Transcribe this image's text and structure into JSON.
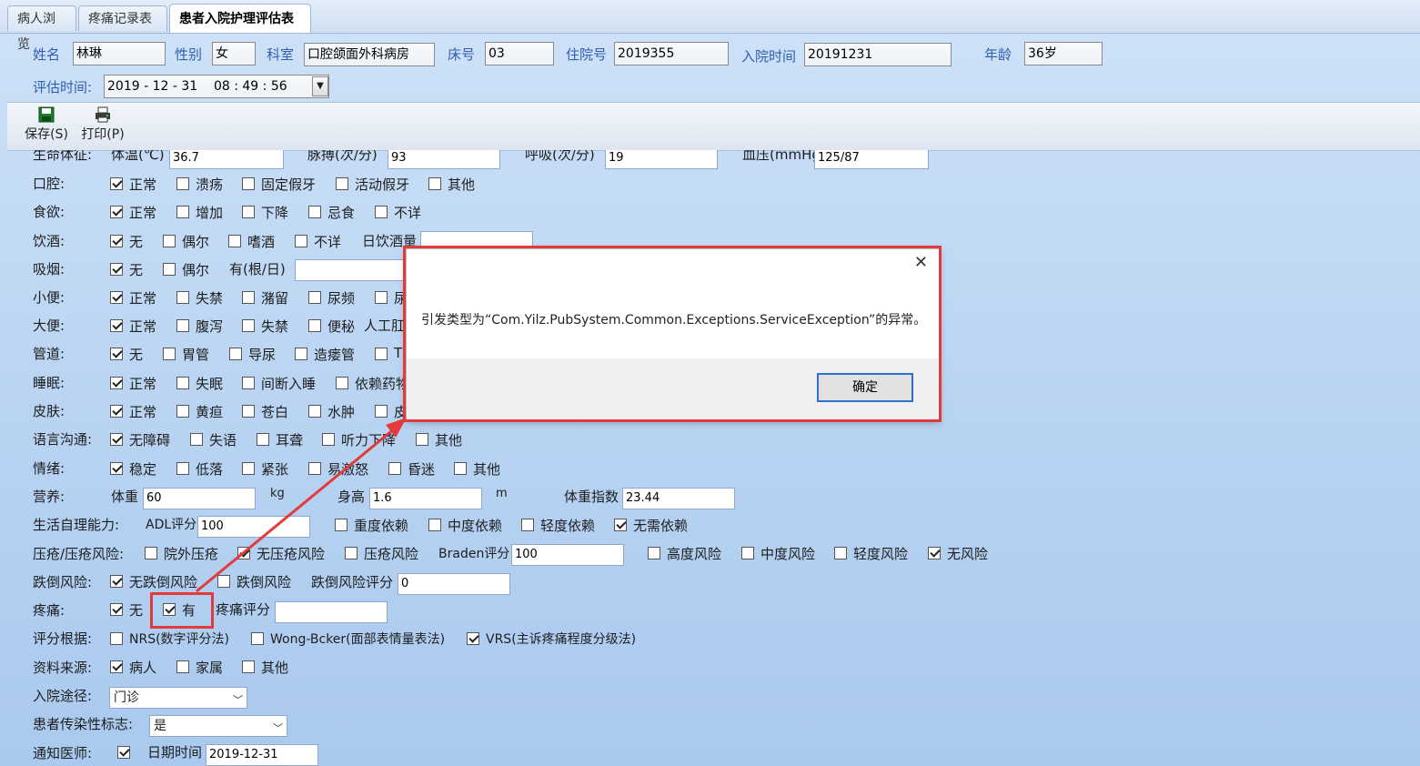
{
  "tabs": [
    "病人浏览",
    "疼痛记录表",
    "患者入院护理评估表"
  ],
  "header": {
    "name_label": "姓名",
    "name_value": "林琳",
    "gender_label": "性别",
    "gender_value": "女",
    "dept_label": "科室",
    "dept_value": "口腔颌面外科病房",
    "bed_label": "床号",
    "bed_value": "03",
    "admission_no_label": "住院号",
    "admission_no_value": "2019355",
    "admit_time_label": "入院时间",
    "admit_time_value": "20191231",
    "age_label": "年龄",
    "age_value": "36岁",
    "assess_time_label": "评估时间:",
    "assess_time_value": "2019 - 12 - 31    08 : 49 : 56"
  },
  "toolbar": {
    "save": "保存(S)",
    "print": "打印(P)"
  },
  "vitals": {
    "label": "生命体征:",
    "temp_label": "体温(℃)",
    "temp_value": "36.7",
    "pulse_label": "脉搏(次/分)",
    "pulse_value": "93",
    "resp_label": "呼吸(次/分)",
    "resp_value": "19",
    "bp_label": "血压(mmHg)",
    "bp_value": "125/87"
  },
  "rows": {
    "oral": {
      "label": "口腔:",
      "opts": [
        "正常",
        "溃疡",
        "固定假牙",
        "活动假牙",
        "其他"
      ]
    },
    "appetite": {
      "label": "食欲:",
      "opts": [
        "正常",
        "增加",
        "下降",
        "忌食",
        "不详"
      ]
    },
    "drink": {
      "label": "饮酒:",
      "opts": [
        "无",
        "偶尔",
        "嗜酒",
        "不详"
      ],
      "daily_label": "日饮酒量"
    },
    "smoke": {
      "label": "吸烟:",
      "opts": [
        "无",
        "偶尔"
      ],
      "per_day_label": "有(根/日)"
    },
    "urine": {
      "label": "小便:",
      "opts": [
        "正常",
        "失禁",
        "潴留",
        "尿频",
        "尿"
      ]
    },
    "stool": {
      "label": "大便:",
      "opts": [
        "正常",
        "腹泻",
        "失禁",
        "便秘"
      ],
      "extra": "人工肛"
    },
    "tube": {
      "label": "管道:",
      "opts": [
        "无",
        "胃管",
        "导尿",
        "造瘘管",
        "T"
      ]
    },
    "sleep": {
      "label": "睡眠:",
      "opts": [
        "正常",
        "失眠",
        "间断入睡",
        "依赖药物"
      ]
    },
    "skin": {
      "label": "皮肤:",
      "opts": [
        "正常",
        "黄疸",
        "苍白",
        "水肿",
        "皮"
      ]
    },
    "language": {
      "label": "语言沟通:",
      "opts": [
        "无障碍",
        "失语",
        "耳聋",
        "听力下降",
        "其他"
      ]
    },
    "mood": {
      "label": "情绪:",
      "opts": [
        "稳定",
        "低落",
        "紧张",
        "易激怒",
        "昏迷",
        "其他"
      ]
    }
  },
  "nutrition": {
    "label": "营养:",
    "weight_label": "体重",
    "weight_value": "60",
    "weight_unit": "kg",
    "height_label": "身高",
    "height_value": "1.6",
    "height_unit": "m",
    "bmi_label": "体重指数",
    "bmi_value": "23.44"
  },
  "selfcare": {
    "label": "生活自理能力:",
    "adl_label": "ADL评分",
    "adl_value": "100",
    "opts": [
      "重度依赖",
      "中度依赖",
      "轻度依赖",
      "无需依赖"
    ]
  },
  "pressure": {
    "label": "压疮/压疮风险:",
    "opts": [
      "院外压疮",
      "无压疮风险",
      "压疮风险"
    ],
    "braden_label": "Braden评分",
    "braden_value": "100",
    "risk_opts": [
      "高度风险",
      "中度风险",
      "轻度风险",
      "无风险"
    ]
  },
  "fall": {
    "label": "跌倒风险:",
    "opts": [
      "无跌倒风险",
      "跌倒风险"
    ],
    "score_label": "跌倒风险评分",
    "score_value": "0"
  },
  "pain": {
    "label": "疼痛:",
    "opts": [
      "无",
      "有"
    ],
    "score_label": "疼痛评分",
    "score_value": ""
  },
  "basis": {
    "label": "评分根据:",
    "opts": [
      "NRS(数字评分法)",
      "Wong-Bcker(面部表情量表法)",
      "VRS(主诉疼痛程度分级法)"
    ]
  },
  "source": {
    "label": "资料来源:",
    "opts": [
      "病人",
      "家属",
      "其他"
    ]
  },
  "route": {
    "label": "入院途径:",
    "value": "门诊"
  },
  "infect": {
    "label": "患者传染性标志:",
    "value": "是"
  },
  "notify": {
    "label": "通知医师:",
    "date_label": "日期时间",
    "date_value": "2019-12-31"
  },
  "dialog": {
    "message": "引发类型为“Com.Yilz.PubSystem.Common.Exceptions.ServiceException”的异常。",
    "ok": "确定"
  },
  "colors": {
    "annotation": "#e23b3b",
    "accent": "#2f6fcf"
  }
}
